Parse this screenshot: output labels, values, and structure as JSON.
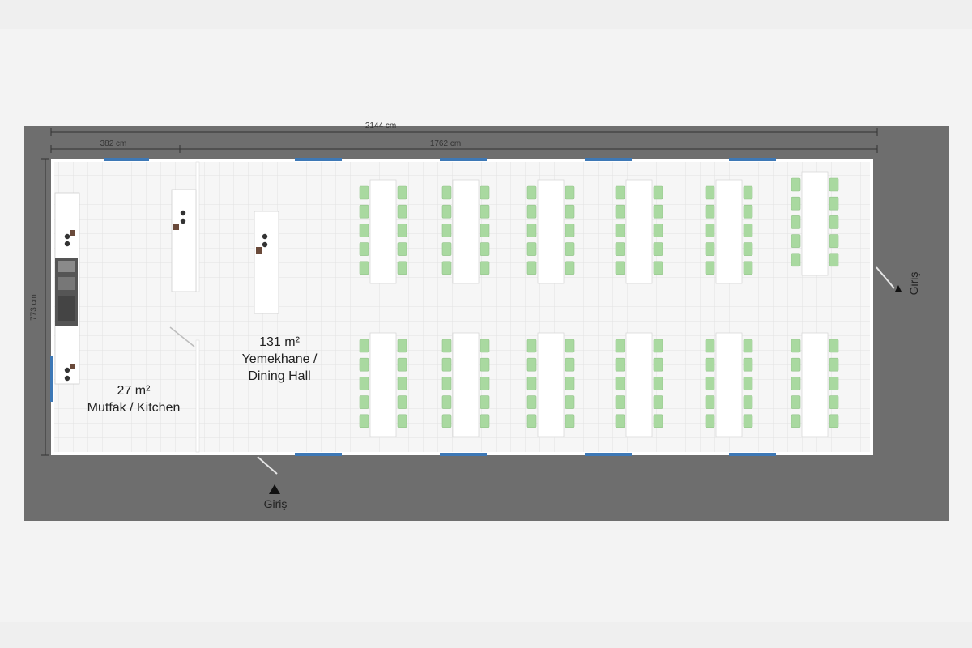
{
  "dimensions": {
    "total_length": "2144 cm",
    "kitchen_length": "382 cm",
    "dining_length": "1762 cm",
    "width": "773 cm"
  },
  "rooms": {
    "dining": {
      "area": "131 m²",
      "name_tr": "Yemekhane /",
      "name_en": "Dining Hall"
    },
    "kitchen": {
      "area": "27 m²",
      "name": "Mutfak / Kitchen"
    }
  },
  "entrances": {
    "right_label": "Giriş",
    "bottom_label": "Giriş"
  },
  "layout_meta": {
    "dining_tables_top_row": 6,
    "dining_tables_bottom_row": 6,
    "chairs_per_table": 10
  },
  "colors": {
    "ground": "#6e6e6e",
    "floor": "#f6f6f6",
    "window": "#3d78b6",
    "chair": "#a9d9a0",
    "table": "#ffffff",
    "wall": "#ffffff"
  }
}
